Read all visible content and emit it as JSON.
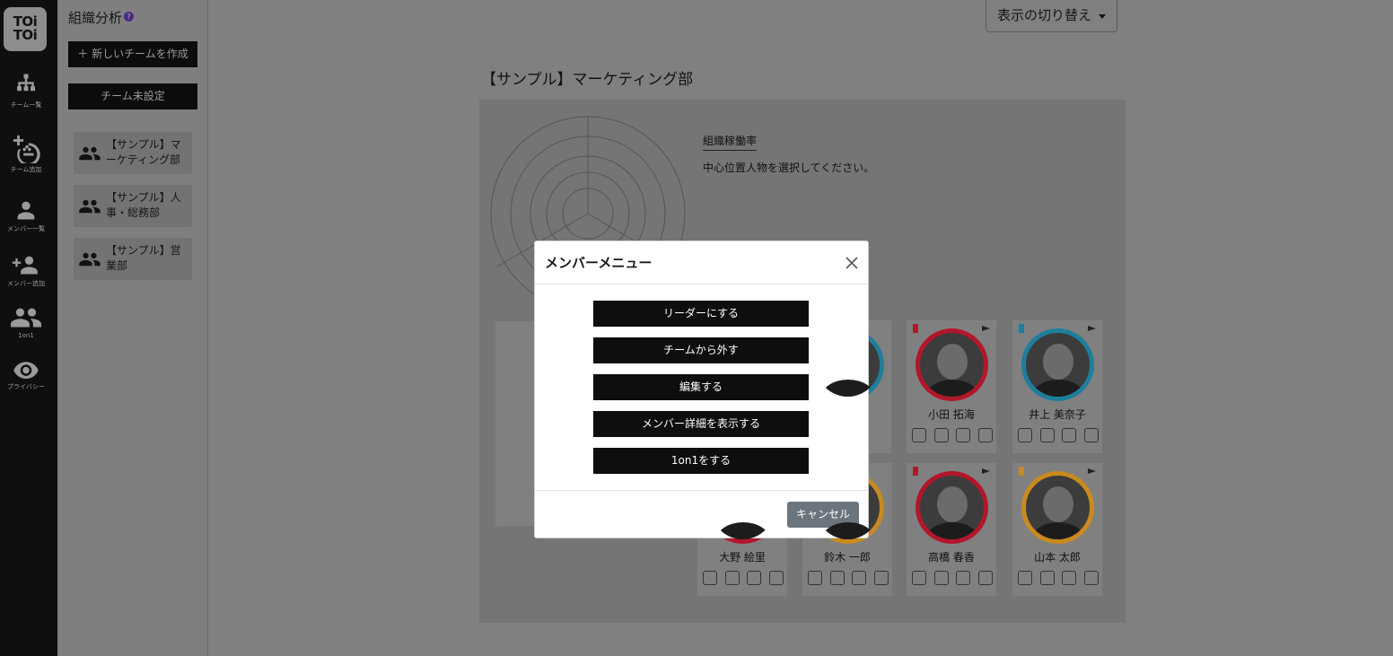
{
  "rail": {
    "logo": "TOi TOi",
    "items": [
      {
        "label": "チーム一覧",
        "icon": "org-chart-icon"
      },
      {
        "label": "チーム追加",
        "icon": "add-team-icon"
      },
      {
        "label": "メンバー一覧",
        "icon": "person-icon"
      },
      {
        "label": "メンバー追加",
        "icon": "add-person-icon"
      },
      {
        "label": "1on1",
        "icon": "people-icon"
      },
      {
        "label": "プライバシー",
        "icon": "eye-icon"
      }
    ]
  },
  "sidebar": {
    "title": "組織分析",
    "help": "?",
    "new_team_label": "＋ 新しいチームを作成",
    "unassigned_label": "チーム未設定",
    "teams": [
      {
        "name": "【サンプル】マーケティング部"
      },
      {
        "name": "【サンプル】人事・総務部"
      },
      {
        "name": "【サンプル】営業部"
      }
    ]
  },
  "main": {
    "view_toggle": "表示の切り替え",
    "department_title": "【サンプル】マーケティング部",
    "operation_rate_label": "組織稼働率",
    "operation_rate_hint": "中心位置人物を選択してください。"
  },
  "members": [
    {
      "name": "小田 拓海",
      "ring_color": "#b3162b"
    },
    {
      "name": "井上 美奈子",
      "ring_color": "#1e7e9c"
    },
    {
      "name": "大野 絵里",
      "ring_color": "#b3162b"
    },
    {
      "name": "鈴木 一郎",
      "ring_color": "#c98a1f"
    },
    {
      "name": "高橋 春香",
      "ring_color": "#b3162b"
    },
    {
      "name": "山本 太郎",
      "ring_color": "#c98a1f"
    }
  ],
  "modal": {
    "title": "メンバーメニュー",
    "buttons": [
      "リーダーにする",
      "チームから外す",
      "編集する",
      "メンバー詳細を表示する",
      "1on1をする"
    ],
    "cancel_label": "キャンセル"
  }
}
